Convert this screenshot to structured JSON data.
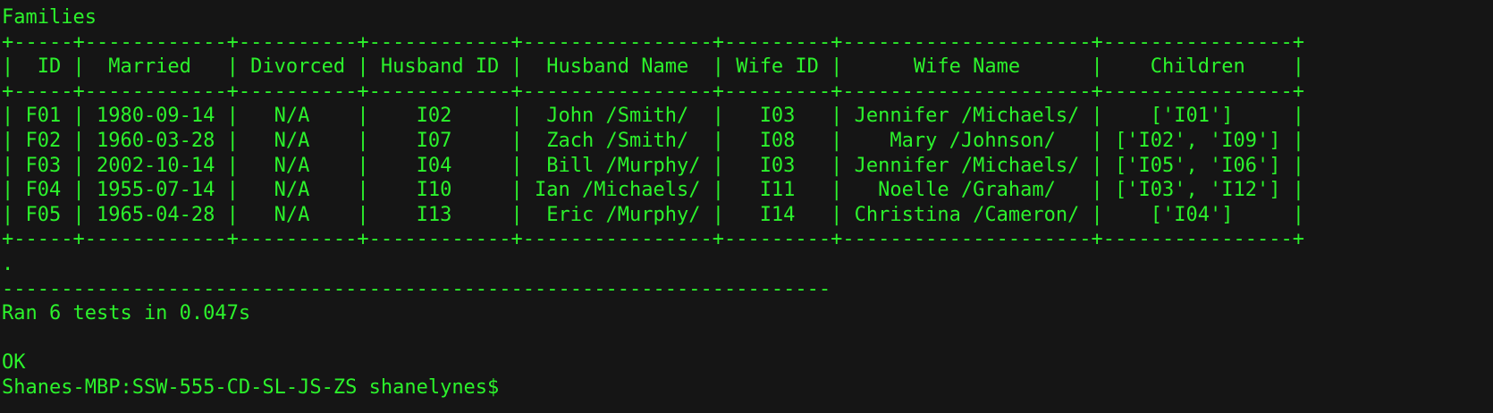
{
  "terminal": {
    "header": "Families",
    "border": "+-----+------------+----------+------------+----------------+---------+---------------------+----------------+",
    "columns_row": "|  ID |  Married   | Divorced | Husband ID |  Husband Name  | Wife ID |      Wife Name      |    Children    |",
    "rows": [
      "| F01 | 1980-09-14 |   N/A    |    I02     |  John /Smith/  |   I03   | Jennifer /Michaels/ |    ['I01']     |",
      "| F02 | 1960-03-28 |   N/A    |    I07     |  Zach /Smith/  |   I08   |    Mary /Johnson/   | ['I02', 'I09'] |",
      "| F03 | 2002-10-14 |   N/A    |    I04     |  Bill /Murphy/ |   I03   | Jennifer /Michaels/ | ['I05', 'I06'] |",
      "| F04 | 1955-07-14 |   N/A    |    I10     | Ian /Michaels/ |   I11   |   Noelle /Graham/   | ['I03', 'I12'] |",
      "| F05 | 1965-04-28 |   N/A    |    I13     |  Eric /Murphy/ |   I14   | Christina /Cameron/ |    ['I04']     |"
    ],
    "dot_line": ".",
    "separator": "----------------------------------------------------------------------",
    "test_summary": "Ran 6 tests in 0.047s",
    "blank": "",
    "status": "OK",
    "prompt": "Shanes-MBP:SSW-555-CD-SL-JS-ZS shanelynes$ "
  },
  "colors": {
    "background": "#151515",
    "text": "#2cf22c"
  }
}
